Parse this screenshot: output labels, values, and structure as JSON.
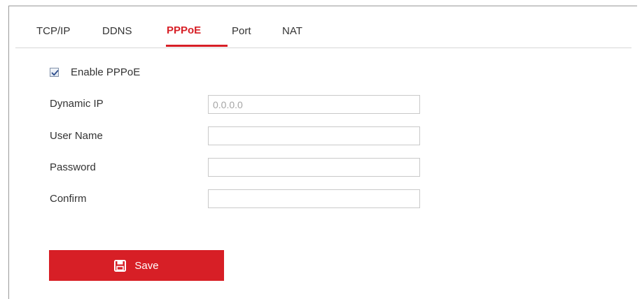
{
  "tabs": [
    {
      "label": "TCP/IP"
    },
    {
      "label": "DDNS"
    },
    {
      "label": "PPPoE"
    },
    {
      "label": "Port"
    },
    {
      "label": "NAT"
    }
  ],
  "active_tab": "PPPoE",
  "enable": {
    "label": "Enable PPPoE",
    "checked": true
  },
  "fields": {
    "dynamic_ip": {
      "label": "Dynamic IP",
      "value": "0.0.0.0"
    },
    "user_name": {
      "label": "User Name",
      "value": ""
    },
    "password": {
      "label": "Password",
      "value": ""
    },
    "confirm": {
      "label": "Confirm",
      "value": ""
    }
  },
  "save": {
    "label": "Save",
    "icon": "floppy-disk-icon"
  },
  "colors": {
    "accent": "#d71f26",
    "text": "#333333",
    "border": "#c9c9c9"
  }
}
